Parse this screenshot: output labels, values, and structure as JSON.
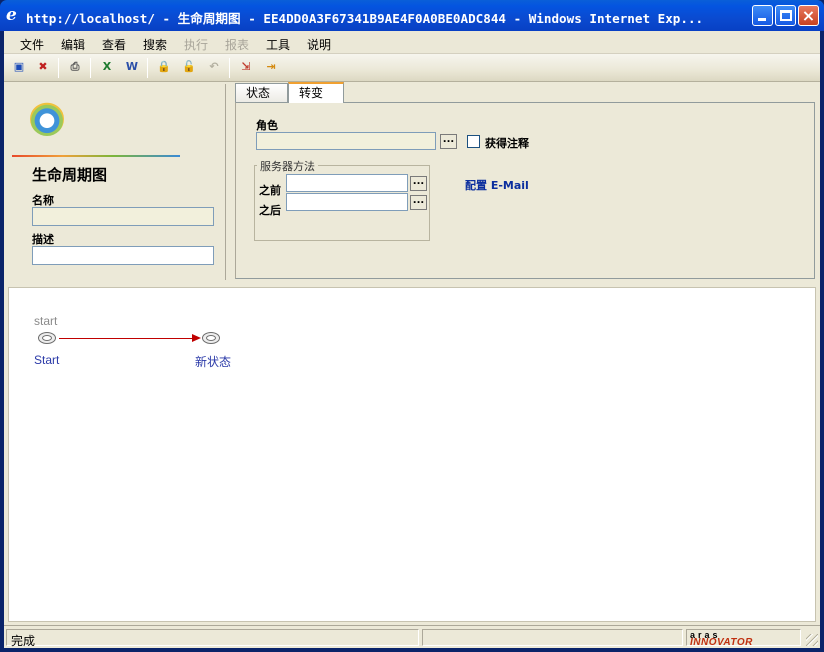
{
  "window": {
    "title": "http://localhost/ - 生命周期图 - EE4DD0A3F67341B9AE4F0A0BE0ADC844 - Windows Internet Exp...",
    "buttons": {
      "minimize": "minimize",
      "maximize": "maximize",
      "close": "×"
    }
  },
  "menu": {
    "items": [
      {
        "label": "文件",
        "enabled": true
      },
      {
        "label": "编辑",
        "enabled": true
      },
      {
        "label": "查看",
        "enabled": true
      },
      {
        "label": "搜索",
        "enabled": true
      },
      {
        "label": "执行",
        "enabled": false
      },
      {
        "label": "报表",
        "enabled": false
      },
      {
        "label": "工具",
        "enabled": true
      },
      {
        "label": "说明",
        "enabled": true
      }
    ]
  },
  "toolbar": {
    "buttons": [
      {
        "icon": "save-icon",
        "glyph": "▣",
        "color": "#1b4bb8"
      },
      {
        "icon": "delete-icon",
        "glyph": "✖",
        "color": "#c02020"
      },
      {
        "icon": "print-icon",
        "glyph": "⎙",
        "color": "#555555"
      },
      {
        "icon": "excel-icon",
        "glyph": "X",
        "color": "#1d7a2e"
      },
      {
        "icon": "word-icon",
        "glyph": "W",
        "color": "#2b4fa8"
      },
      {
        "icon": "lock-icon",
        "glyph": "🔒",
        "color": "#b3b0a0"
      },
      {
        "icon": "unlock-icon",
        "glyph": "🔓",
        "color": "#b3b0a0"
      },
      {
        "icon": "undo-icon",
        "glyph": "↶",
        "color": "#b3b0a0"
      },
      {
        "icon": "done-icon",
        "glyph": "⇲",
        "color": "#c0392b"
      },
      {
        "icon": "exit-icon",
        "glyph": "⇥",
        "color": "#d48a10"
      }
    ]
  },
  "left_panel": {
    "title": "生命周期图",
    "name_label": "名称",
    "name_value": "",
    "description_label": "描述",
    "description_value": ""
  },
  "tabs": [
    {
      "label": "状态",
      "active": false
    },
    {
      "label": "转变",
      "active": true
    }
  ],
  "transition_form": {
    "role_label": "角色",
    "role_value": "",
    "get_comment_label": "获得注释",
    "get_comment_checked": false,
    "server_methods_legend": "服务器方法",
    "before_label": "之前",
    "before_value": "",
    "after_label": "之后",
    "after_value": "",
    "ellipsis": "...",
    "email_link": "配置 E-Mail"
  },
  "diagram": {
    "nodes": [
      {
        "caption": "start",
        "label": "Start"
      },
      {
        "caption": "",
        "label": "新状态"
      }
    ],
    "edge_color": "#c00000"
  },
  "status_bar": {
    "text": "完成",
    "brand_top": "aras",
    "brand_bottom": "INNOVATOR"
  }
}
